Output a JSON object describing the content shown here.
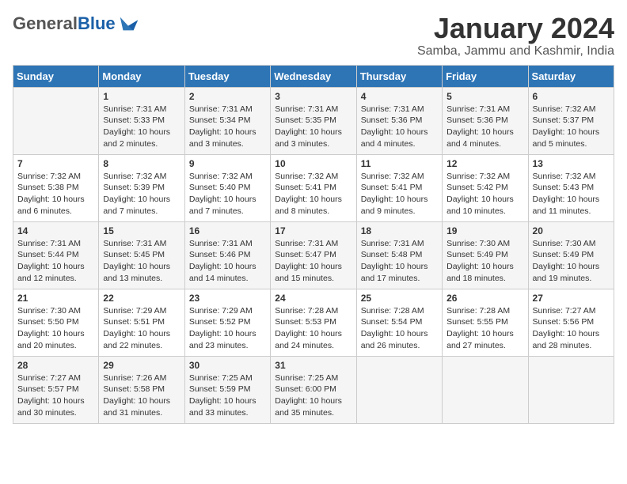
{
  "logo": {
    "general": "General",
    "blue": "Blue"
  },
  "header": {
    "month": "January 2024",
    "location": "Samba, Jammu and Kashmir, India"
  },
  "days_of_week": [
    "Sunday",
    "Monday",
    "Tuesday",
    "Wednesday",
    "Thursday",
    "Friday",
    "Saturday"
  ],
  "weeks": [
    [
      {
        "day": "",
        "info": ""
      },
      {
        "day": "1",
        "info": "Sunrise: 7:31 AM\nSunset: 5:33 PM\nDaylight: 10 hours\nand 2 minutes."
      },
      {
        "day": "2",
        "info": "Sunrise: 7:31 AM\nSunset: 5:34 PM\nDaylight: 10 hours\nand 3 minutes."
      },
      {
        "day": "3",
        "info": "Sunrise: 7:31 AM\nSunset: 5:35 PM\nDaylight: 10 hours\nand 3 minutes."
      },
      {
        "day": "4",
        "info": "Sunrise: 7:31 AM\nSunset: 5:36 PM\nDaylight: 10 hours\nand 4 minutes."
      },
      {
        "day": "5",
        "info": "Sunrise: 7:31 AM\nSunset: 5:36 PM\nDaylight: 10 hours\nand 4 minutes."
      },
      {
        "day": "6",
        "info": "Sunrise: 7:32 AM\nSunset: 5:37 PM\nDaylight: 10 hours\nand 5 minutes."
      }
    ],
    [
      {
        "day": "7",
        "info": "Sunrise: 7:32 AM\nSunset: 5:38 PM\nDaylight: 10 hours\nand 6 minutes."
      },
      {
        "day": "8",
        "info": "Sunrise: 7:32 AM\nSunset: 5:39 PM\nDaylight: 10 hours\nand 7 minutes."
      },
      {
        "day": "9",
        "info": "Sunrise: 7:32 AM\nSunset: 5:40 PM\nDaylight: 10 hours\nand 7 minutes."
      },
      {
        "day": "10",
        "info": "Sunrise: 7:32 AM\nSunset: 5:41 PM\nDaylight: 10 hours\nand 8 minutes."
      },
      {
        "day": "11",
        "info": "Sunrise: 7:32 AM\nSunset: 5:41 PM\nDaylight: 10 hours\nand 9 minutes."
      },
      {
        "day": "12",
        "info": "Sunrise: 7:32 AM\nSunset: 5:42 PM\nDaylight: 10 hours\nand 10 minutes."
      },
      {
        "day": "13",
        "info": "Sunrise: 7:32 AM\nSunset: 5:43 PM\nDaylight: 10 hours\nand 11 minutes."
      }
    ],
    [
      {
        "day": "14",
        "info": "Sunrise: 7:31 AM\nSunset: 5:44 PM\nDaylight: 10 hours\nand 12 minutes."
      },
      {
        "day": "15",
        "info": "Sunrise: 7:31 AM\nSunset: 5:45 PM\nDaylight: 10 hours\nand 13 minutes."
      },
      {
        "day": "16",
        "info": "Sunrise: 7:31 AM\nSunset: 5:46 PM\nDaylight: 10 hours\nand 14 minutes."
      },
      {
        "day": "17",
        "info": "Sunrise: 7:31 AM\nSunset: 5:47 PM\nDaylight: 10 hours\nand 15 minutes."
      },
      {
        "day": "18",
        "info": "Sunrise: 7:31 AM\nSunset: 5:48 PM\nDaylight: 10 hours\nand 17 minutes."
      },
      {
        "day": "19",
        "info": "Sunrise: 7:30 AM\nSunset: 5:49 PM\nDaylight: 10 hours\nand 18 minutes."
      },
      {
        "day": "20",
        "info": "Sunrise: 7:30 AM\nSunset: 5:49 PM\nDaylight: 10 hours\nand 19 minutes."
      }
    ],
    [
      {
        "day": "21",
        "info": "Sunrise: 7:30 AM\nSunset: 5:50 PM\nDaylight: 10 hours\nand 20 minutes."
      },
      {
        "day": "22",
        "info": "Sunrise: 7:29 AM\nSunset: 5:51 PM\nDaylight: 10 hours\nand 22 minutes."
      },
      {
        "day": "23",
        "info": "Sunrise: 7:29 AM\nSunset: 5:52 PM\nDaylight: 10 hours\nand 23 minutes."
      },
      {
        "day": "24",
        "info": "Sunrise: 7:28 AM\nSunset: 5:53 PM\nDaylight: 10 hours\nand 24 minutes."
      },
      {
        "day": "25",
        "info": "Sunrise: 7:28 AM\nSunset: 5:54 PM\nDaylight: 10 hours\nand 26 minutes."
      },
      {
        "day": "26",
        "info": "Sunrise: 7:28 AM\nSunset: 5:55 PM\nDaylight: 10 hours\nand 27 minutes."
      },
      {
        "day": "27",
        "info": "Sunrise: 7:27 AM\nSunset: 5:56 PM\nDaylight: 10 hours\nand 28 minutes."
      }
    ],
    [
      {
        "day": "28",
        "info": "Sunrise: 7:27 AM\nSunset: 5:57 PM\nDaylight: 10 hours\nand 30 minutes."
      },
      {
        "day": "29",
        "info": "Sunrise: 7:26 AM\nSunset: 5:58 PM\nDaylight: 10 hours\nand 31 minutes."
      },
      {
        "day": "30",
        "info": "Sunrise: 7:25 AM\nSunset: 5:59 PM\nDaylight: 10 hours\nand 33 minutes."
      },
      {
        "day": "31",
        "info": "Sunrise: 7:25 AM\nSunset: 6:00 PM\nDaylight: 10 hours\nand 35 minutes."
      },
      {
        "day": "",
        "info": ""
      },
      {
        "day": "",
        "info": ""
      },
      {
        "day": "",
        "info": ""
      }
    ]
  ]
}
